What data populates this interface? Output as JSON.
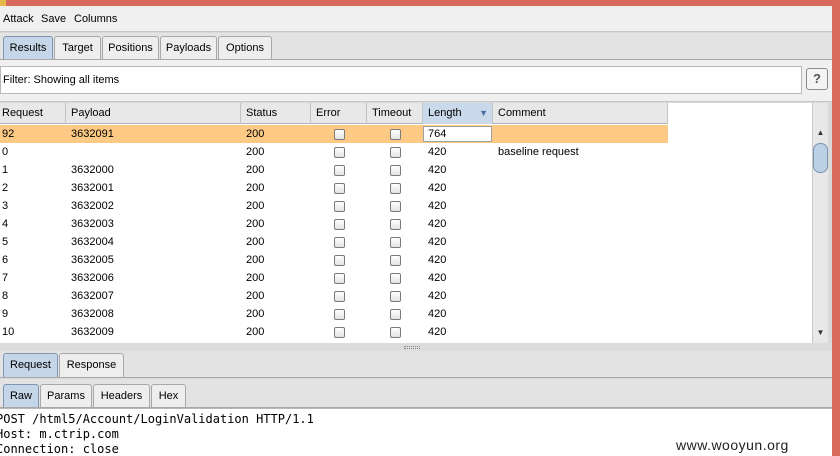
{
  "menu": {
    "items": [
      "Attack",
      "Save",
      "Columns"
    ]
  },
  "main_tabs": {
    "items": [
      "Results",
      "Target",
      "Positions",
      "Payloads",
      "Options"
    ],
    "active": "Results"
  },
  "filter": {
    "text": "Filter:  Showing all items",
    "help_label": "?"
  },
  "table": {
    "columns": [
      "Request",
      "Payload",
      "Status",
      "Error",
      "Timeout",
      "Length",
      "Comment"
    ],
    "sorted_column": "Length",
    "rows": [
      {
        "request": "92",
        "payload": "3632091",
        "status": "200",
        "error": false,
        "timeout": false,
        "length": "764",
        "comment": "",
        "selected": true
      },
      {
        "request": "0",
        "payload": "",
        "status": "200",
        "error": false,
        "timeout": false,
        "length": "420",
        "comment": "baseline request",
        "selected": false
      },
      {
        "request": "1",
        "payload": "3632000",
        "status": "200",
        "error": false,
        "timeout": false,
        "length": "420",
        "comment": "",
        "selected": false
      },
      {
        "request": "2",
        "payload": "3632001",
        "status": "200",
        "error": false,
        "timeout": false,
        "length": "420",
        "comment": "",
        "selected": false
      },
      {
        "request": "3",
        "payload": "3632002",
        "status": "200",
        "error": false,
        "timeout": false,
        "length": "420",
        "comment": "",
        "selected": false
      },
      {
        "request": "4",
        "payload": "3632003",
        "status": "200",
        "error": false,
        "timeout": false,
        "length": "420",
        "comment": "",
        "selected": false
      },
      {
        "request": "5",
        "payload": "3632004",
        "status": "200",
        "error": false,
        "timeout": false,
        "length": "420",
        "comment": "",
        "selected": false
      },
      {
        "request": "6",
        "payload": "3632005",
        "status": "200",
        "error": false,
        "timeout": false,
        "length": "420",
        "comment": "",
        "selected": false
      },
      {
        "request": "7",
        "payload": "3632006",
        "status": "200",
        "error": false,
        "timeout": false,
        "length": "420",
        "comment": "",
        "selected": false
      },
      {
        "request": "8",
        "payload": "3632007",
        "status": "200",
        "error": false,
        "timeout": false,
        "length": "420",
        "comment": "",
        "selected": false
      },
      {
        "request": "9",
        "payload": "3632008",
        "status": "200",
        "error": false,
        "timeout": false,
        "length": "420",
        "comment": "",
        "selected": false
      },
      {
        "request": "10",
        "payload": "3632009",
        "status": "200",
        "error": false,
        "timeout": false,
        "length": "420",
        "comment": "",
        "selected": false
      }
    ]
  },
  "message_tabs": {
    "items": [
      "Request",
      "Response"
    ],
    "active": "Request"
  },
  "view_tabs": {
    "items": [
      "Raw",
      "Params",
      "Headers",
      "Hex"
    ],
    "active": "Raw"
  },
  "raw": {
    "lines": [
      "POST /html5/Account/LoginValidation HTTP/1.1",
      "Host: m.ctrip.com",
      "Connection: close"
    ]
  },
  "watermark": "www.wooyun.org",
  "colors": {
    "selected_row": "#fcca84",
    "active_tab": "#c5d6e8",
    "frame": "#d86a5c"
  }
}
